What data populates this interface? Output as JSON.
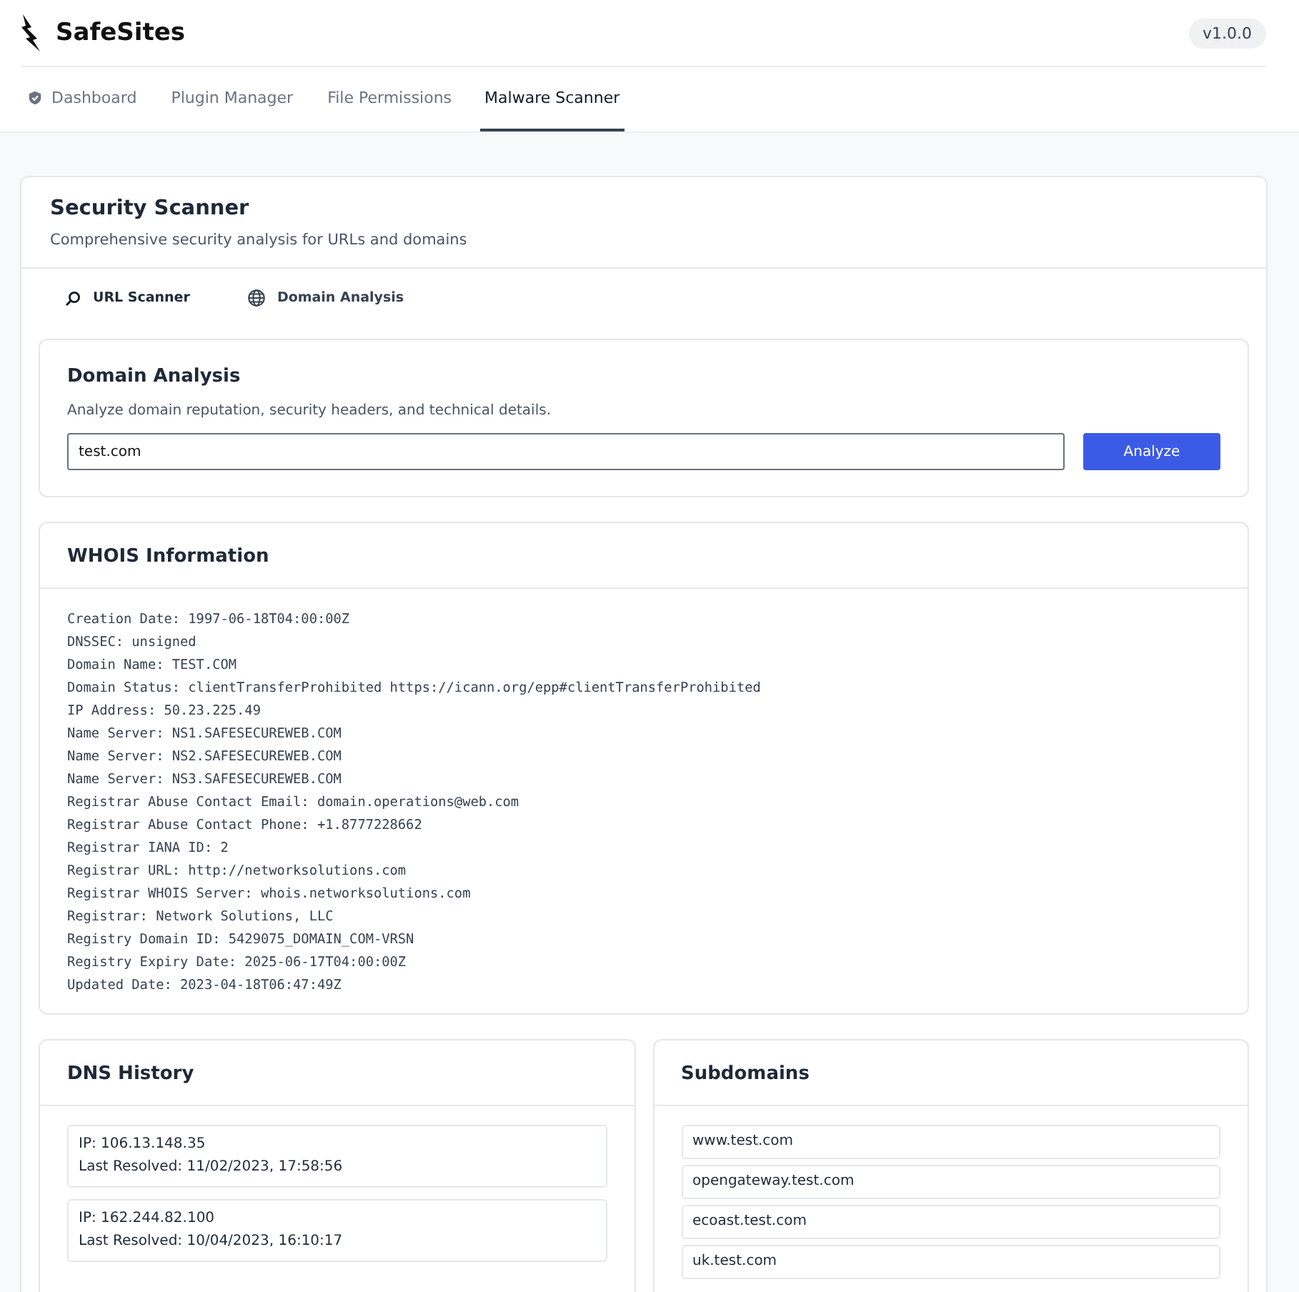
{
  "app": {
    "name": "SafeSites",
    "version": "v1.0.0"
  },
  "nav": [
    {
      "label": "Dashboard",
      "selected": false
    },
    {
      "label": "Plugin Manager",
      "selected": false
    },
    {
      "label": "File Permissions",
      "selected": false
    },
    {
      "label": "Malware Scanner",
      "selected": true
    }
  ],
  "scanner": {
    "title": "Security Scanner",
    "subtitle": "Comprehensive security analysis for URLs and domains",
    "tabs": [
      {
        "label": "URL Scanner",
        "selected": false
      },
      {
        "label": "Domain Analysis",
        "selected": true
      }
    ]
  },
  "analysis": {
    "title": "Domain Analysis",
    "description": "Analyze domain reputation, security headers, and technical details.",
    "value": "test.com",
    "button": "Analyze"
  },
  "whois": {
    "title": "WHOIS Information",
    "lines": [
      "Creation Date: 1997-06-18T04:00:00Z",
      "DNSSEC: unsigned",
      "Domain Name: TEST.COM",
      "Domain Status: clientTransferProhibited https://icann.org/epp#clientTransferProhibited",
      "IP Address: 50.23.225.49",
      "Name Server: NS1.SAFESECUREWEB.COM",
      "Name Server: NS2.SAFESECUREWEB.COM",
      "Name Server: NS3.SAFESECUREWEB.COM",
      "Registrar Abuse Contact Email: domain.operations@web.com",
      "Registrar Abuse Contact Phone: +1.8777228662",
      "Registrar IANA ID: 2",
      "Registrar URL: http://networksolutions.com",
      "Registrar WHOIS Server: whois.networksolutions.com",
      "Registrar: Network Solutions, LLC",
      "Registry Domain ID: 5429075_DOMAIN_COM-VRSN",
      "Registry Expiry Date: 2025-06-17T04:00:00Z",
      "Updated Date: 2023-04-18T06:47:49Z"
    ]
  },
  "dns_history": {
    "title": "DNS History",
    "entries": [
      {
        "ip": "IP: 106.13.148.35",
        "resolved": "Last Resolved: 11/02/2023, 17:58:56"
      },
      {
        "ip": "IP: 162.244.82.100",
        "resolved": "Last Resolved: 10/04/2023, 16:10:17"
      }
    ]
  },
  "subdomains": {
    "title": "Subdomains",
    "items": [
      "www.test.com",
      "opengateway.test.com",
      "ecoast.test.com",
      "uk.test.com"
    ]
  }
}
